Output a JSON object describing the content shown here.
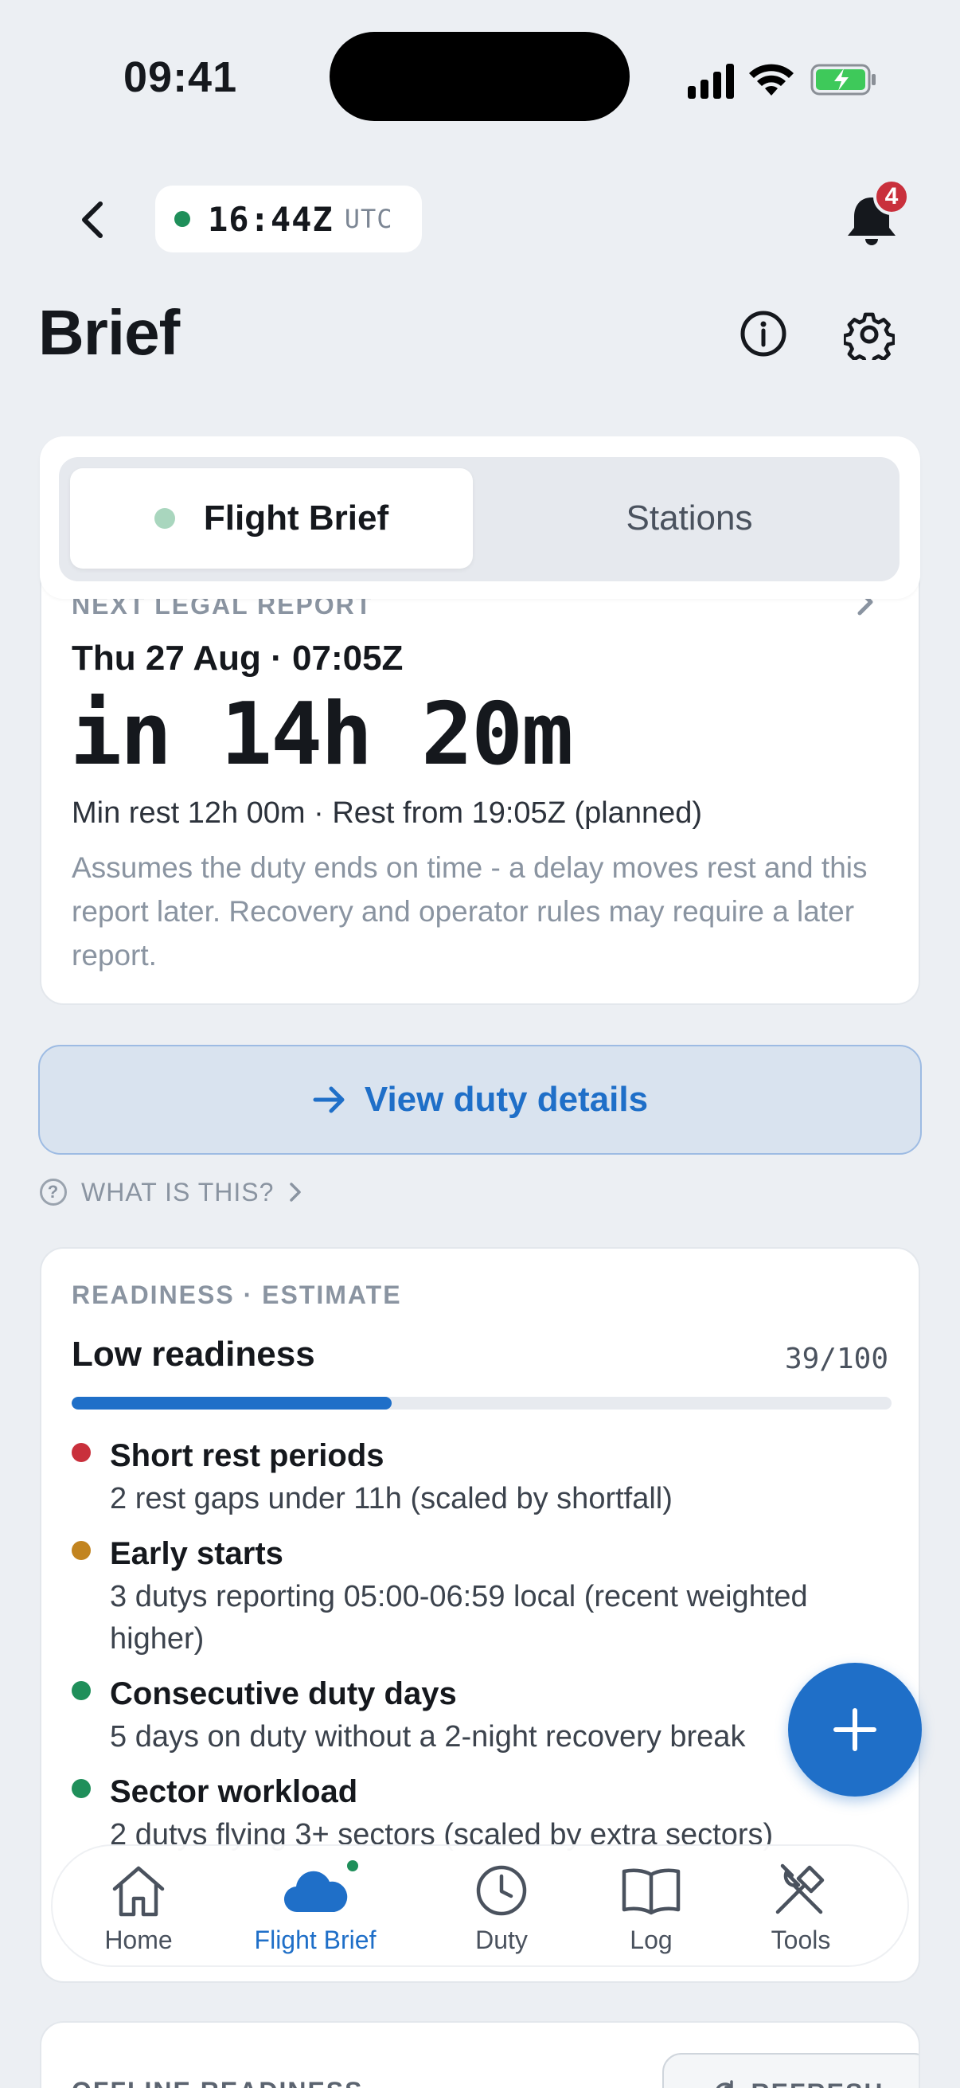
{
  "status_bar": {
    "time": "09:41"
  },
  "header": {
    "utc_time": "16:44Z",
    "utc_label": "UTC",
    "notification_count": "4",
    "title": "Brief"
  },
  "segmented": {
    "tabs": [
      {
        "label": "Flight Brief",
        "active": true
      },
      {
        "label": "Stations",
        "active": false
      }
    ]
  },
  "report": {
    "label": "NEXT LEGAL REPORT",
    "date": "Thu 27 Aug · 07:05Z",
    "countdown": "in 14h 20m",
    "rest": "Min rest 12h 00m · Rest from 19:05Z (planned)",
    "note": "Assumes the duty ends on time - a delay moves rest and this report later. Recovery and operator rules may require a later report."
  },
  "duty_button": {
    "label": "View duty details"
  },
  "what_link": {
    "label": "WHAT IS THIS?"
  },
  "readiness": {
    "label": "READINESS · ESTIMATE",
    "title": "Low readiness",
    "score": "39/100",
    "score_value": 39,
    "score_max": 100,
    "factors": [
      {
        "name": "Short rest periods",
        "desc": "2 rest gaps under 11h (scaled by shortfall)",
        "color": "#c9303c"
      },
      {
        "name": "Early starts",
        "desc": "3 dutys reporting 05:00-06:59 local (recent weighted higher)",
        "color": "#c2841f"
      },
      {
        "name": "Consecutive duty days",
        "desc": "5 days on duty without a 2-night recovery break",
        "color": "#1f8f5a"
      },
      {
        "name": "Sector workload",
        "desc": "2 dutys flying 3+ sectors (scaled by extra sectors)",
        "color": "#1f8f5a"
      }
    ]
  },
  "nav": {
    "items": [
      {
        "label": "Home",
        "icon": "home-icon"
      },
      {
        "label": "Flight Brief",
        "icon": "cloud-icon",
        "active": true
      },
      {
        "label": "Duty",
        "icon": "clock-icon"
      },
      {
        "label": "Log",
        "icon": "book-icon"
      },
      {
        "label": "Tools",
        "icon": "tools-icon"
      }
    ]
  },
  "offline": {
    "label": "OFFLINE READINESS",
    "refresh_label": "REFRESH"
  },
  "colors": {
    "accent": "#1f6fc8",
    "ok": "#1f8f5a",
    "danger": "#c9303c",
    "warning": "#c2841f"
  }
}
